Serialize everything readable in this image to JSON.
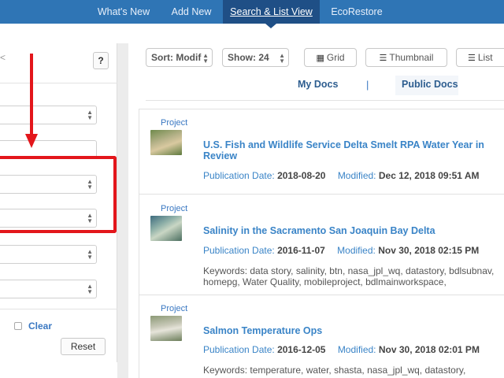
{
  "nav": {
    "items": [
      {
        "label": "What's New"
      },
      {
        "label": "Add New"
      },
      {
        "label": "Search & List View",
        "active": true
      },
      {
        "label": "EcoRestore"
      }
    ]
  },
  "left_panel": {
    "glyph": "<",
    "help_label": "?",
    "clear_label": "Clear",
    "reset_label": "Reset"
  },
  "toolbar": {
    "sort_label": "Sort: Modif",
    "show_label": "Show: 24",
    "grid_label": "Grid",
    "thumbnail_label": "Thumbnail",
    "list_label": "List"
  },
  "doc_tabs": {
    "my_docs": "My Docs",
    "separator": "|",
    "public_docs": "Public Docs"
  },
  "results": [
    {
      "type": "Project",
      "title": "U.S. Fish and Wildlife Service Delta Smelt RPA Water Year in Review",
      "pub_label": "Publication Date:",
      "pub_date": "2018-08-20",
      "mod_label": "Modified:",
      "modified": "Dec 12, 2018 09:51 AM",
      "keywords": ""
    },
    {
      "type": "Project",
      "title": "Salinity in the Sacramento San Joaquin Bay Delta",
      "pub_label": "Publication Date:",
      "pub_date": "2016-11-07",
      "mod_label": "Modified:",
      "modified": "Nov 30, 2018 02:15 PM",
      "keywords": "Keywords: data story, salinity, btn, nasa_jpl_wq, datastory, bdlsubnav, homepg, Water Quality, mobileproject, bdlmainworkspace,"
    },
    {
      "type": "Project",
      "title": "Salmon Temperature Ops",
      "pub_label": "Publication Date:",
      "pub_date": "2016-12-05",
      "mod_label": "Modified:",
      "modified": "Nov 30, 2018 02:01 PM",
      "keywords": "Keywords: temperature, water, shasta, nasa_jpl_wq, datastory,"
    }
  ],
  "colors": {
    "nav_bg": "#2f75b5",
    "nav_active": "#1f4f86",
    "link": "#3a84c7",
    "highlight_red": "#e3161b"
  }
}
